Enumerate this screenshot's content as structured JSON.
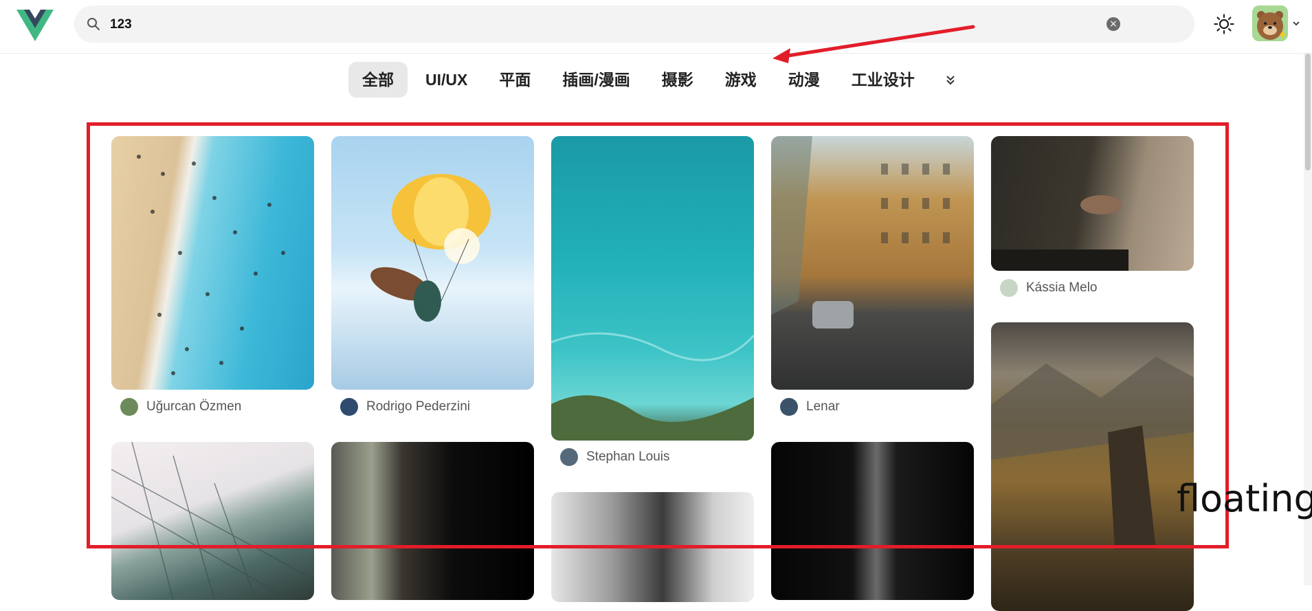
{
  "search": {
    "value": "123"
  },
  "categories": {
    "items": [
      "全部",
      "UI/UX",
      "平面",
      "插画/漫画",
      "摄影",
      "游戏",
      "动漫",
      "工业设计"
    ],
    "active_index": 0
  },
  "photos": [
    {
      "author": "Uğurcan Özmen",
      "theme": "beach"
    },
    {
      "author": "Rodrigo Pederzini",
      "theme": "parachute"
    },
    {
      "author": "Stephan Louis",
      "theme": "sea"
    },
    {
      "author": "Lenar",
      "theme": "street"
    },
    {
      "author": "Kássia Melo",
      "theme": "hands"
    },
    {
      "theme": "mountain"
    },
    {
      "theme": "glass-building"
    },
    {
      "theme": "window"
    },
    {
      "theme": "guitar"
    },
    {
      "theme": "dark-light"
    }
  ],
  "overlay_text": "floating",
  "colors": {
    "annotation": "#e21d2a",
    "logo_green": "#41b883",
    "logo_dark": "#34495e"
  }
}
